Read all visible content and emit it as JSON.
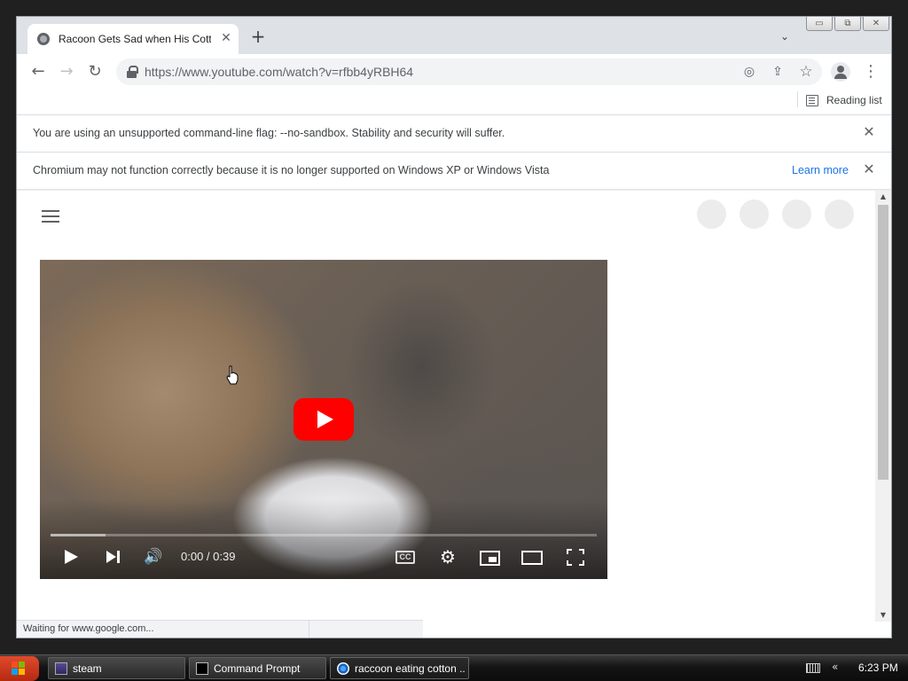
{
  "browser": {
    "tab": {
      "title": "Racoon Gets Sad when His Cotton Candy",
      "close_symbol": "✕"
    },
    "new_tab_symbol": "+",
    "tab_search_symbol": "⌄",
    "window_controls": {
      "minimize": "▭",
      "restore": "⧉",
      "close": "✕"
    },
    "toolbar": {
      "back_symbol": "←",
      "forward_symbol": "→",
      "reload_symbol": "↻",
      "url": "https://www.youtube.com/watch?v=rfbb4yRBH64",
      "eye_off_symbol": "◎",
      "share_symbol": "⇪",
      "bookmark_symbol": "☆",
      "menu_symbol": "⋮"
    },
    "bookmarks_bar": {
      "reading_list_label": "Reading list"
    },
    "infobars": [
      {
        "text": "You are using an unsupported command-line flag: --no-sandbox. Stability and security will suffer.",
        "close_symbol": "✕"
      },
      {
        "text": "Chromium may not function correctly because it is no longer supported on Windows XP or Windows Vista",
        "link": "Learn more",
        "close_symbol": "✕"
      }
    ],
    "status_text": "Waiting for www.google.com..."
  },
  "youtube": {
    "player": {
      "time": "0:00 / 0:39",
      "cc_label": "CC",
      "progress_loaded_fraction": 0.1,
      "volume_symbol": "🔊",
      "settings_symbol": "⚙"
    }
  },
  "scrollbar": {
    "up_symbol": "▲",
    "down_symbol": "▼"
  },
  "taskbar": {
    "items": [
      {
        "label": "steam"
      },
      {
        "label": "Command Prompt"
      },
      {
        "label": "raccoon eating cotton ..."
      }
    ],
    "tray_chevron": "«",
    "clock": "6:23 PM"
  },
  "colors": {
    "accent_link": "#1a73e8",
    "youtube_red": "#ff0000",
    "start_button": "#c8361a"
  }
}
